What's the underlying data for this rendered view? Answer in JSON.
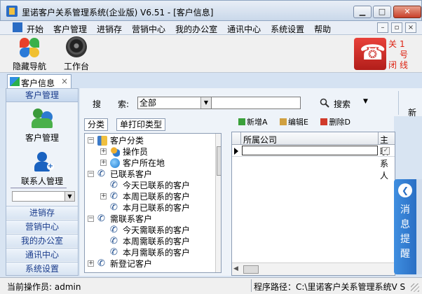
{
  "window": {
    "title": "里诺客户关系管理系统(企业版) V6.51 - [客户信息]",
    "minimize_glyph": "▁",
    "maximize_glyph": "□",
    "close_glyph": "✕"
  },
  "menubar": {
    "items": [
      "开始",
      "客户管理",
      "进销存",
      "营销中心",
      "我的办公室",
      "通讯中心",
      "系统设置",
      "帮助"
    ],
    "mdi_minimize": "–",
    "mdi_restore": "▫",
    "mdi_close": "×"
  },
  "toolbar": {
    "hide_nav_label": "隐藏导航",
    "workbench_label": "工作台",
    "close_label_chars": [
      "关",
      "1",
      "号",
      "闭",
      "线"
    ]
  },
  "doc_tabs": [
    {
      "label": "客户信息",
      "close": "×"
    }
  ],
  "leftnav": {
    "header": "客户管理",
    "big_items": [
      {
        "label": "客户管理",
        "icon": "users-icon"
      },
      {
        "label": "联系人管理",
        "icon": "contact-add-icon"
      }
    ],
    "links": [
      "进销存",
      "营销中心",
      "我的办公室",
      "通讯中心",
      "系统设置"
    ],
    "scroll_arrow": "▼"
  },
  "search": {
    "label_1": "搜",
    "label_2": "索:",
    "select_value": "全部",
    "select_arrow": "▼",
    "input_value": "",
    "button_label": "搜索",
    "drop_arrow": "▼",
    "new_cut": "新"
  },
  "tree_tabs": [
    "分类",
    "单打印类型"
  ],
  "tree": {
    "nodes": [
      {
        "level": 0,
        "exp": "−",
        "icon": "book",
        "label": "客户分类"
      },
      {
        "level": 1,
        "exp": "+",
        "icon": "users",
        "label": "操作员"
      },
      {
        "level": 1,
        "exp": "+",
        "icon": "globe",
        "label": "客户所在地"
      },
      {
        "level": 0,
        "exp": "−",
        "icon": "phone",
        "label": "已联系客户"
      },
      {
        "level": 1,
        "exp": "",
        "icon": "phone",
        "label": "今天已联系的客户"
      },
      {
        "level": 1,
        "exp": "+",
        "icon": "phone",
        "label": "本周已联系的客户"
      },
      {
        "level": 1,
        "exp": "",
        "icon": "phone",
        "label": "本月已联系的客户"
      },
      {
        "level": 0,
        "exp": "−",
        "icon": "phone",
        "label": "需联系客户"
      },
      {
        "level": 1,
        "exp": "",
        "icon": "phone",
        "label": "今天需联系的客户"
      },
      {
        "level": 1,
        "exp": "",
        "icon": "phone",
        "label": "本周需联系的客户"
      },
      {
        "level": 1,
        "exp": "",
        "icon": "phone",
        "label": "本月需联系的客户"
      },
      {
        "level": 0,
        "exp": "+",
        "icon": "phone",
        "label": "新登记客户"
      }
    ]
  },
  "grid": {
    "tools": [
      "新增A",
      "编辑E",
      "删除D"
    ],
    "columns": [
      "所属公司",
      "主联系人"
    ],
    "row_checked": "✓",
    "hscroll_arrow": "◀"
  },
  "message_panel": {
    "arrow": "❮",
    "chars": [
      "消",
      "息",
      "提",
      "醒"
    ]
  },
  "status": {
    "operator": "当前操作员: admin",
    "path": "程序路径：C:\\里诺客户关系管理系统V S"
  },
  "colors": {
    "accent_blue": "#2a6fc4",
    "phone_red": "#c8241e",
    "close_text_red": "#dd2211"
  }
}
